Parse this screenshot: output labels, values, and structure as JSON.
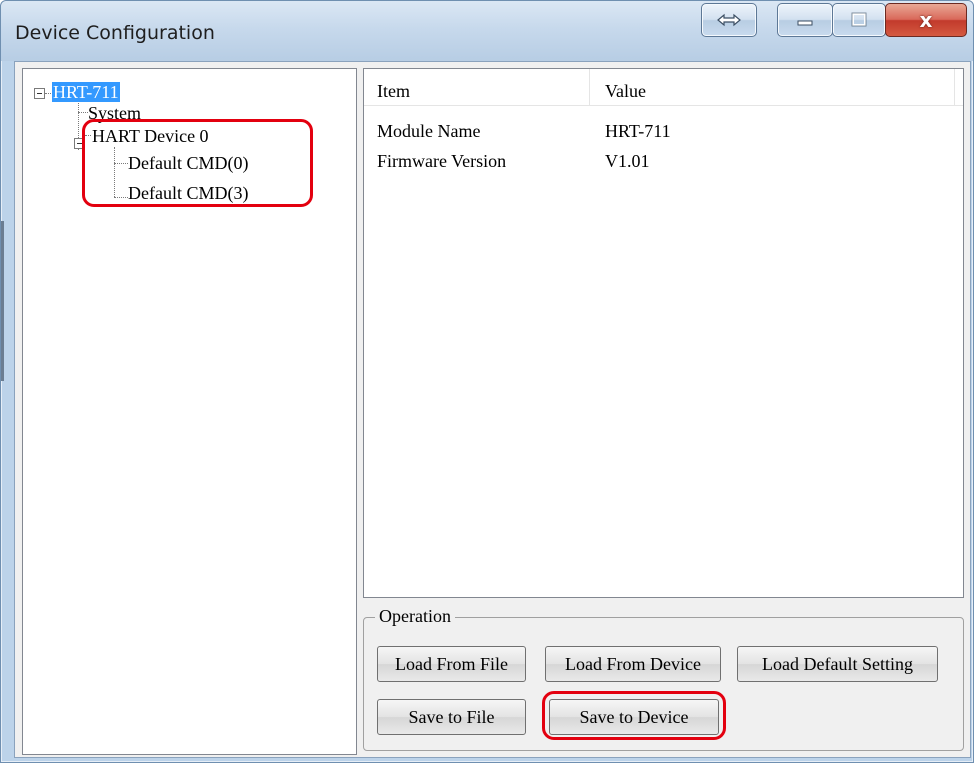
{
  "window": {
    "title": "Device Configuration",
    "controls": {
      "resize_icon": "double-arrow-icon",
      "minimize_icon": "minimize-icon",
      "maximize_icon": "maximize-icon",
      "close_label": "x"
    }
  },
  "tree": {
    "root": {
      "label": "HRT-711",
      "expanded": true,
      "selected": true
    },
    "items": [
      {
        "label": "System"
      },
      {
        "label": "HART Device 0",
        "expanded": true,
        "children": [
          {
            "label": "Default CMD(0)"
          },
          {
            "label": "Default CMD(3)"
          }
        ]
      }
    ]
  },
  "list": {
    "columns": [
      "Item",
      "Value"
    ],
    "rows": [
      {
        "item": "Module Name",
        "value": "HRT-711"
      },
      {
        "item": "Firmware Version",
        "value": "V1.01"
      }
    ]
  },
  "operation": {
    "title": "Operation",
    "buttons": {
      "load_from_file": "Load From File",
      "load_from_device": "Load From Device",
      "load_default_setting": "Load Default Setting",
      "save_to_file": "Save to File",
      "save_to_device": "Save to Device"
    }
  },
  "highlight_color": "#e3000f",
  "selection_color": "#3399ff"
}
